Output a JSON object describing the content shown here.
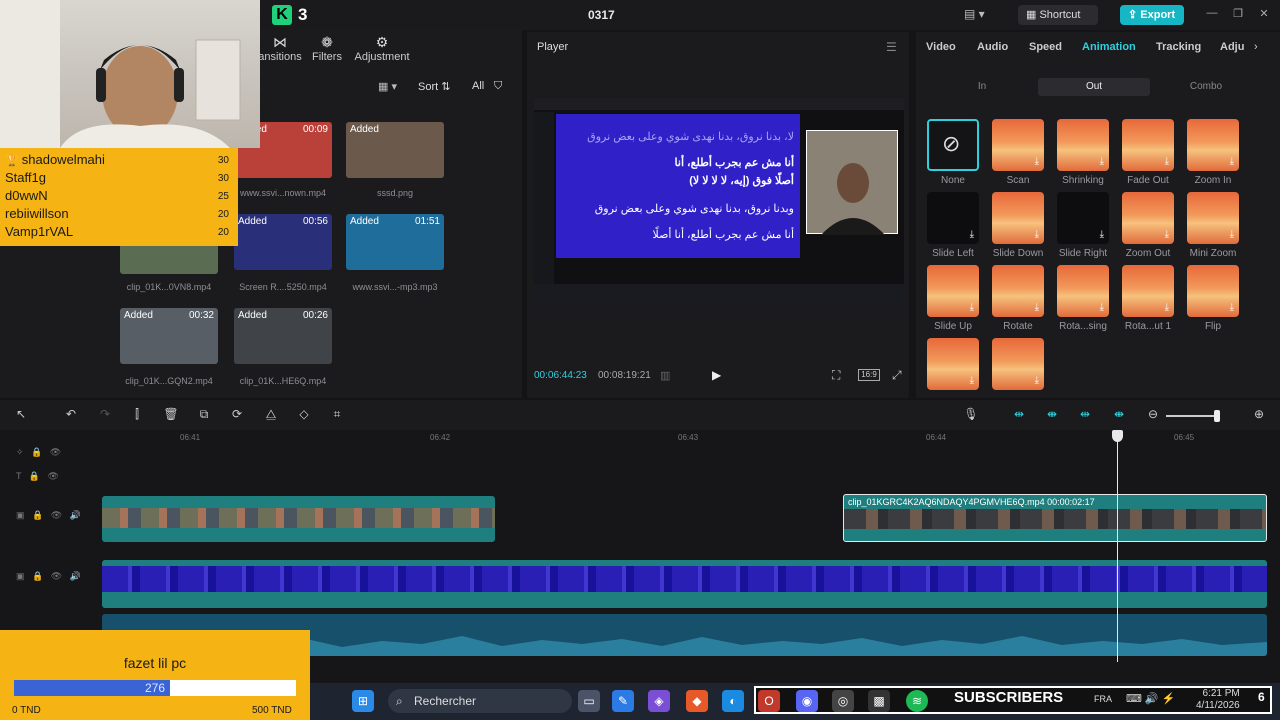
{
  "window": {
    "app_badge": "3",
    "project_title": "0317",
    "shortcut_label": "Shortcut",
    "export_label": "Export"
  },
  "media": {
    "tools": [
      {
        "label": "ansitions",
        "icon": "transitions-icon"
      },
      {
        "label": "Filters",
        "icon": "filters-icon"
      },
      {
        "label": "Adjustment",
        "icon": "adjustment-icon"
      }
    ],
    "sort_label": "Sort",
    "all_label": "All",
    "clips": [
      {
        "added": "Added",
        "duration": "00:09",
        "name": "www.ssvi...nown.mp4",
        "tone": "#b9413a"
      },
      {
        "added": "Added",
        "duration": "",
        "name": "sssd.png",
        "tone": "#6b5a4c"
      },
      {
        "added": "Added",
        "duration": "00:56",
        "name": "Screen R....5250.mp4",
        "tone": "#2a2f7a"
      },
      {
        "added": "Added",
        "duration": "01:51",
        "name": "www.ssvi...-mp3.mp3",
        "tone": "#1f6d9a"
      },
      {
        "added": "",
        "duration": "",
        "name": "clip_01K...0VN8.mp4",
        "tone": "#5a6d52"
      },
      {
        "added": "Added",
        "duration": "00:32",
        "name": "clip_01K...GQN2.mp4",
        "tone": "#585e66"
      },
      {
        "added": "Added",
        "duration": "00:26",
        "name": "clip_01K...HE6Q.mp4",
        "tone": "#404448"
      }
    ]
  },
  "chat": {
    "rows": [
      {
        "user": "shadowelmahi",
        "count": "30"
      },
      {
        "user": "Staff1g",
        "count": "30"
      },
      {
        "user": "d0wwN",
        "count": "25"
      },
      {
        "user": "rebiiwillson",
        "count": "20"
      },
      {
        "user": "Vamp1rVAL",
        "count": "20"
      }
    ]
  },
  "player": {
    "title": "Player",
    "current_time": "00:06:44:23",
    "total_time": "00:08:19:21",
    "ratio": "16:9",
    "lyrics": [
      "لا، بدنا نروق، بدنا نهدى شوي وعلى بعض نروق",
      "أنا مش عم بجرب أطلع، أنا",
      "أصلًا فوق (إيه، لا لا لا لا)",
      "وبدنا نروق، بدنا نهدى شوي وعلى بعض نروق",
      "أنا مش عم بجرب أطلع، أنا أصلًا"
    ]
  },
  "properties": {
    "tabs": [
      "Video",
      "Audio",
      "Speed",
      "Animation",
      "Tracking",
      "Adju"
    ],
    "active_tab": "Animation",
    "sub_tabs": [
      "In",
      "Out",
      "Combo"
    ],
    "active_sub_tab": "Out",
    "animations": [
      "None",
      "Scan",
      "Shrinking",
      "Fade Out",
      "Zoom In",
      "Slide Left",
      "Slide Down",
      "Slide Right",
      "Zoom Out",
      "Mini Zoom",
      "Slide Up",
      "Rotate",
      "Rota...sing",
      "Rota...ut 1",
      "Flip",
      "",
      ""
    ]
  },
  "timeline": {
    "ruler": [
      "06:41",
      "06:42",
      "06:43",
      "06:44",
      "06:45"
    ],
    "clip_label": "clip_01KGRC4K2AQ6NDAQY4PGMVHE6Q.mp4  00:00:02:17"
  },
  "donation": {
    "title": "fazet lil pc",
    "amount": "276",
    "min": "0 TND",
    "max": "500 TND",
    "progress": 0.552
  },
  "taskbar": {
    "search_placeholder": "Rechercher",
    "subscribers_label": "SUBSCRIBERS",
    "language": "FRA",
    "time": "6:21 PM",
    "date": "4/11/2026",
    "notification_count": "6"
  }
}
